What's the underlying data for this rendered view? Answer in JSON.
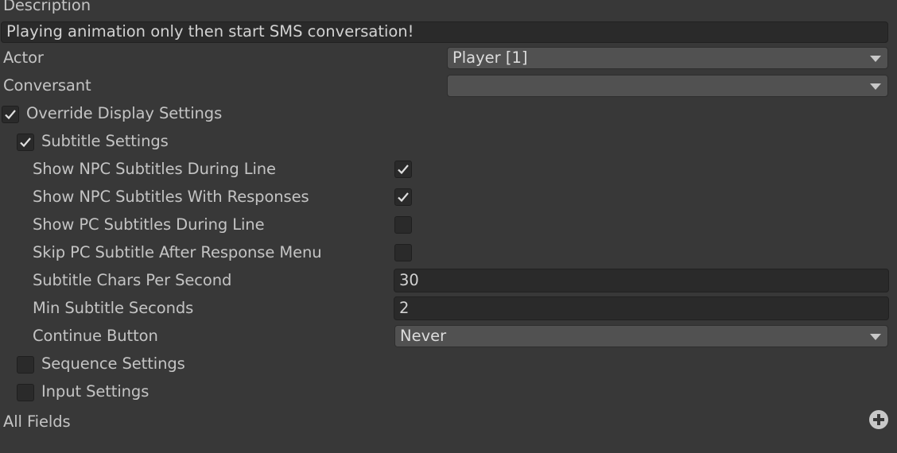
{
  "description": {
    "label": "Description",
    "value": "Playing animation only then start SMS conversation!"
  },
  "actor": {
    "label": "Actor",
    "value": "Player [1]"
  },
  "conversant": {
    "label": "Conversant",
    "value": ""
  },
  "override_display_settings": {
    "label": "Override Display Settings",
    "checked": true
  },
  "subtitle_settings": {
    "label": "Subtitle Settings",
    "checked": true,
    "show_npc_during_line": {
      "label": "Show NPC Subtitles During Line",
      "checked": true
    },
    "show_npc_with_responses": {
      "label": "Show NPC Subtitles With Responses",
      "checked": true
    },
    "show_pc_during_line": {
      "label": "Show PC Subtitles During Line",
      "checked": false
    },
    "skip_pc_after_response": {
      "label": "Skip PC Subtitle After Response Menu",
      "checked": false
    },
    "chars_per_second": {
      "label": "Subtitle Chars Per Second",
      "value": "30"
    },
    "min_seconds": {
      "label": "Min Subtitle Seconds",
      "value": "2"
    },
    "continue_button": {
      "label": "Continue Button",
      "value": "Never"
    }
  },
  "sequence_settings": {
    "label": "Sequence Settings",
    "checked": false
  },
  "input_settings": {
    "label": "Input Settings",
    "checked": false
  },
  "all_fields": {
    "label": "All Fields"
  },
  "icons": {
    "checkmark": "checkmark-icon",
    "dropdown": "chevron-down-icon",
    "add": "plus-circle-icon"
  }
}
